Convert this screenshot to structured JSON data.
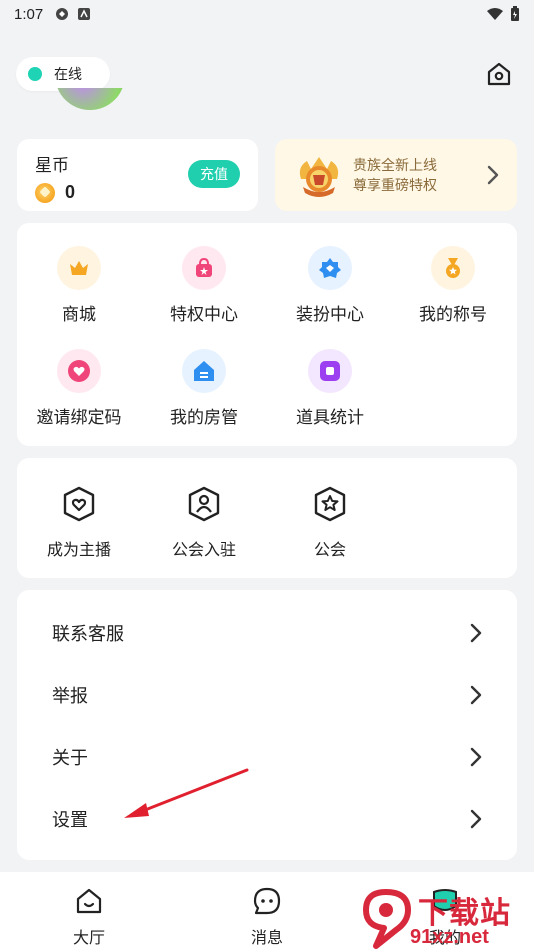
{
  "status_bar": {
    "time": "1:07"
  },
  "header": {
    "online_label": "在线"
  },
  "coin_card": {
    "title": "星币",
    "value": "0",
    "recharge_label": "充值"
  },
  "noble_card": {
    "line1": "贵族全新上线",
    "line2": "尊享重磅特权"
  },
  "features": [
    {
      "label": "商城",
      "icon": "crown-icon",
      "color": "#f5a623",
      "bg": "#fff4e0"
    },
    {
      "label": "特权中心",
      "icon": "gift-bag-icon",
      "color": "#f0457a",
      "bg": "#ffe8ef"
    },
    {
      "label": "装扮中心",
      "icon": "star-badge-icon",
      "color": "#2f8ff0",
      "bg": "#e6f2ff"
    },
    {
      "label": "我的称号",
      "icon": "medal-icon",
      "color": "#f5a623",
      "bg": "#fff4e0"
    },
    {
      "label": "邀请绑定码",
      "icon": "heart-icon",
      "color": "#f0457a",
      "bg": "#ffe8ef"
    },
    {
      "label": "我的房管",
      "icon": "house-icon",
      "color": "#2f8ff0",
      "bg": "#e6f2ff"
    },
    {
      "label": "道具统计",
      "icon": "box-icon",
      "color": "#9b3ff0",
      "bg": "#f3e6ff"
    }
  ],
  "guild_section": [
    {
      "label": "成为主播",
      "icon": "heart-shield-icon"
    },
    {
      "label": "公会入驻",
      "icon": "person-shield-icon"
    },
    {
      "label": "公会",
      "icon": "star-shield-icon"
    }
  ],
  "menu_list": [
    {
      "label": "联系客服"
    },
    {
      "label": "举报"
    },
    {
      "label": "关于"
    },
    {
      "label": "设置"
    }
  ],
  "tab_bar": [
    {
      "label": "大厅",
      "icon": "home-smile-icon"
    },
    {
      "label": "消息",
      "icon": "chat-face-icon"
    },
    {
      "label": "我的",
      "icon": "profile-icon"
    }
  ],
  "watermark": {
    "top": "下载站",
    "bottom": "91xz.net"
  },
  "colors": {
    "accent": "#1fcfae",
    "background": "#f2f3f5",
    "annotation": "#e0202e"
  }
}
